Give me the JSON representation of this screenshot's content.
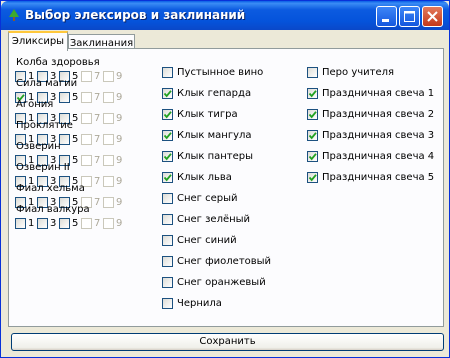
{
  "window": {
    "title": "Выбор элексиров и заклинаний"
  },
  "tabs": [
    "Эликсиры",
    "Заклинания"
  ],
  "elixirs": [
    {
      "name": "Колба здоровья",
      "checked": []
    },
    {
      "name": "Сила магии",
      "checked": [
        "1"
      ]
    },
    {
      "name": "Агония",
      "checked": []
    },
    {
      "name": "Проклятие",
      "checked": []
    },
    {
      "name": "Озверин",
      "checked": []
    },
    {
      "name": "Озверин II",
      "checked": []
    },
    {
      "name": "Фиал хельма",
      "checked": []
    },
    {
      "name": "Фиал валкура",
      "checked": []
    }
  ],
  "levels": [
    "1",
    "3",
    "5",
    "7",
    "9"
  ],
  "disabled_levels": [
    "7",
    "9"
  ],
  "col2": [
    {
      "label": "Пустынное вино",
      "checked": false
    },
    {
      "label": "Клык гепарда",
      "checked": true
    },
    {
      "label": "Клык тигра",
      "checked": true
    },
    {
      "label": "Клык мангула",
      "checked": true
    },
    {
      "label": "Клык пантеры",
      "checked": true
    },
    {
      "label": "Клык льва",
      "checked": true
    },
    {
      "label": "Снег серый",
      "checked": false
    },
    {
      "label": "Снег зелёный",
      "checked": false
    },
    {
      "label": "Снег синий",
      "checked": false
    },
    {
      "label": "Снег фиолетовый",
      "checked": false
    },
    {
      "label": "Снег оранжевый",
      "checked": false
    },
    {
      "label": "Чернила",
      "checked": false
    }
  ],
  "col3": [
    {
      "label": "Перо учителя",
      "checked": false
    },
    {
      "label": "Праздничная свеча 1",
      "checked": true
    },
    {
      "label": "Праздничная свеча 2",
      "checked": true
    },
    {
      "label": "Праздничная свеча 3",
      "checked": true
    },
    {
      "label": "Праздничная свеча 4",
      "checked": true
    },
    {
      "label": "Праздничная свеча 5",
      "checked": true
    }
  ],
  "save_label": "Сохранить",
  "colors": {
    "titlebar": "#0553DB",
    "check": "#21A121",
    "tab_highlight": "#FFC83C"
  }
}
